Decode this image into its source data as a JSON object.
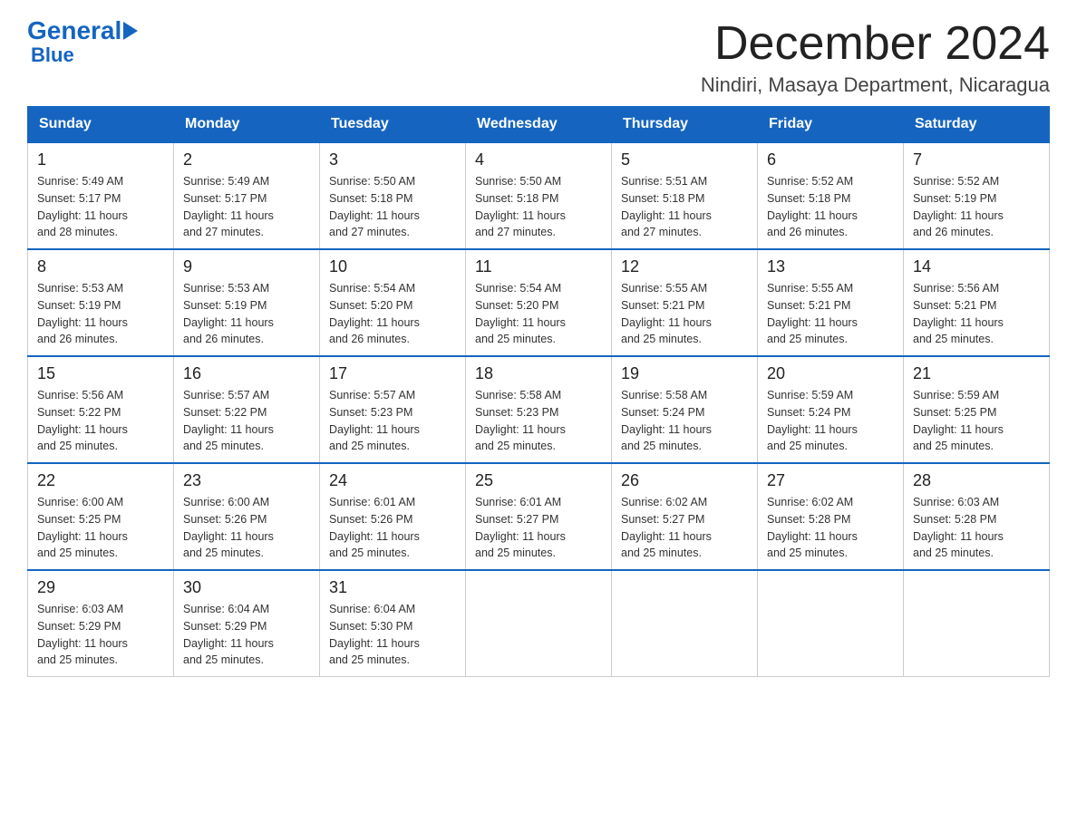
{
  "header": {
    "logo_text_general": "General",
    "logo_text_blue": "Blue",
    "month_title": "December 2024",
    "location": "Nindiri, Masaya Department, Nicaragua"
  },
  "days_of_week": [
    "Sunday",
    "Monday",
    "Tuesday",
    "Wednesday",
    "Thursday",
    "Friday",
    "Saturday"
  ],
  "weeks": [
    [
      {
        "day": "1",
        "sunrise": "5:49 AM",
        "sunset": "5:17 PM",
        "daylight": "11 hours and 28 minutes."
      },
      {
        "day": "2",
        "sunrise": "5:49 AM",
        "sunset": "5:17 PM",
        "daylight": "11 hours and 27 minutes."
      },
      {
        "day": "3",
        "sunrise": "5:50 AM",
        "sunset": "5:18 PM",
        "daylight": "11 hours and 27 minutes."
      },
      {
        "day": "4",
        "sunrise": "5:50 AM",
        "sunset": "5:18 PM",
        "daylight": "11 hours and 27 minutes."
      },
      {
        "day": "5",
        "sunrise": "5:51 AM",
        "sunset": "5:18 PM",
        "daylight": "11 hours and 27 minutes."
      },
      {
        "day": "6",
        "sunrise": "5:52 AM",
        "sunset": "5:18 PM",
        "daylight": "11 hours and 26 minutes."
      },
      {
        "day": "7",
        "sunrise": "5:52 AM",
        "sunset": "5:19 PM",
        "daylight": "11 hours and 26 minutes."
      }
    ],
    [
      {
        "day": "8",
        "sunrise": "5:53 AM",
        "sunset": "5:19 PM",
        "daylight": "11 hours and 26 minutes."
      },
      {
        "day": "9",
        "sunrise": "5:53 AM",
        "sunset": "5:19 PM",
        "daylight": "11 hours and 26 minutes."
      },
      {
        "day": "10",
        "sunrise": "5:54 AM",
        "sunset": "5:20 PM",
        "daylight": "11 hours and 26 minutes."
      },
      {
        "day": "11",
        "sunrise": "5:54 AM",
        "sunset": "5:20 PM",
        "daylight": "11 hours and 25 minutes."
      },
      {
        "day": "12",
        "sunrise": "5:55 AM",
        "sunset": "5:21 PM",
        "daylight": "11 hours and 25 minutes."
      },
      {
        "day": "13",
        "sunrise": "5:55 AM",
        "sunset": "5:21 PM",
        "daylight": "11 hours and 25 minutes."
      },
      {
        "day": "14",
        "sunrise": "5:56 AM",
        "sunset": "5:21 PM",
        "daylight": "11 hours and 25 minutes."
      }
    ],
    [
      {
        "day": "15",
        "sunrise": "5:56 AM",
        "sunset": "5:22 PM",
        "daylight": "11 hours and 25 minutes."
      },
      {
        "day": "16",
        "sunrise": "5:57 AM",
        "sunset": "5:22 PM",
        "daylight": "11 hours and 25 minutes."
      },
      {
        "day": "17",
        "sunrise": "5:57 AM",
        "sunset": "5:23 PM",
        "daylight": "11 hours and 25 minutes."
      },
      {
        "day": "18",
        "sunrise": "5:58 AM",
        "sunset": "5:23 PM",
        "daylight": "11 hours and 25 minutes."
      },
      {
        "day": "19",
        "sunrise": "5:58 AM",
        "sunset": "5:24 PM",
        "daylight": "11 hours and 25 minutes."
      },
      {
        "day": "20",
        "sunrise": "5:59 AM",
        "sunset": "5:24 PM",
        "daylight": "11 hours and 25 minutes."
      },
      {
        "day": "21",
        "sunrise": "5:59 AM",
        "sunset": "5:25 PM",
        "daylight": "11 hours and 25 minutes."
      }
    ],
    [
      {
        "day": "22",
        "sunrise": "6:00 AM",
        "sunset": "5:25 PM",
        "daylight": "11 hours and 25 minutes."
      },
      {
        "day": "23",
        "sunrise": "6:00 AM",
        "sunset": "5:26 PM",
        "daylight": "11 hours and 25 minutes."
      },
      {
        "day": "24",
        "sunrise": "6:01 AM",
        "sunset": "5:26 PM",
        "daylight": "11 hours and 25 minutes."
      },
      {
        "day": "25",
        "sunrise": "6:01 AM",
        "sunset": "5:27 PM",
        "daylight": "11 hours and 25 minutes."
      },
      {
        "day": "26",
        "sunrise": "6:02 AM",
        "sunset": "5:27 PM",
        "daylight": "11 hours and 25 minutes."
      },
      {
        "day": "27",
        "sunrise": "6:02 AM",
        "sunset": "5:28 PM",
        "daylight": "11 hours and 25 minutes."
      },
      {
        "day": "28",
        "sunrise": "6:03 AM",
        "sunset": "5:28 PM",
        "daylight": "11 hours and 25 minutes."
      }
    ],
    [
      {
        "day": "29",
        "sunrise": "6:03 AM",
        "sunset": "5:29 PM",
        "daylight": "11 hours and 25 minutes."
      },
      {
        "day": "30",
        "sunrise": "6:04 AM",
        "sunset": "5:29 PM",
        "daylight": "11 hours and 25 minutes."
      },
      {
        "day": "31",
        "sunrise": "6:04 AM",
        "sunset": "5:30 PM",
        "daylight": "11 hours and 25 minutes."
      },
      null,
      null,
      null,
      null
    ]
  ],
  "labels": {
    "sunrise": "Sunrise:",
    "sunset": "Sunset:",
    "daylight": "Daylight:"
  },
  "colors": {
    "header_bg": "#1565c0",
    "header_text": "#ffffff",
    "border": "#1565c0",
    "logo_blue": "#1565c0"
  }
}
